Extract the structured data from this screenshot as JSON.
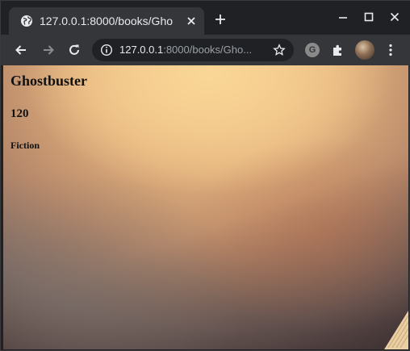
{
  "tab": {
    "title": "127.0.0.1:8000/books/Gho",
    "favicon": "globe-icon"
  },
  "toolbar": {
    "url_host": "127.0.0.1",
    "url_rest": ":8000/books/Gho...",
    "extension_letter": "G"
  },
  "book": {
    "title": "Ghostbuster",
    "pages": "120",
    "genre": "Fiction"
  },
  "colors": {
    "frame": "#202124",
    "toolbar": "#35363a",
    "omnibox": "#202124",
    "text_light": "#e8eaed",
    "text_dim": "#9aa0a6",
    "background_warm": "#f1c98d",
    "background_dark": "#4c3a38"
  }
}
